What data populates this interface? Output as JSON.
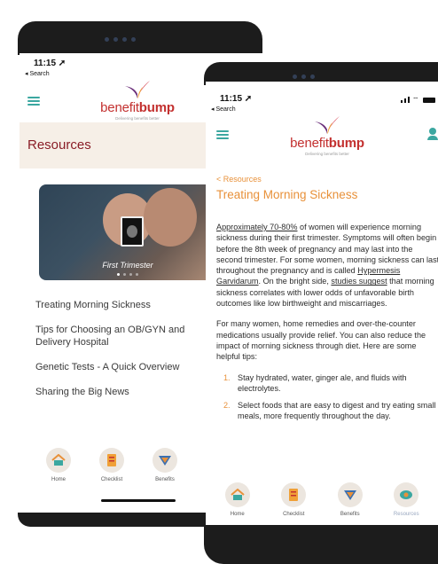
{
  "back_phone": {
    "status_time": "11:15",
    "status_back": "◂ Search",
    "logo": {
      "word_1": "benefit",
      "word_2": "bump",
      "tagline": "Delivering benefits better"
    },
    "section_title": "Resources",
    "carousel_caption": "First Trimester",
    "links": [
      "Treating Morning Sickness",
      "Tips for Choosing an OB/GYN and Delivery Hospital",
      "Genetic Tests - A Quick Overview",
      "Sharing the Big News"
    ],
    "nav": [
      "Home",
      "Checklist",
      "Benefits"
    ]
  },
  "front_phone": {
    "status_time": "11:15",
    "status_back": "◂ Search",
    "logo": {
      "word_1": "benefit",
      "word_2": "bump",
      "tagline": "Delivering benefits better"
    },
    "back_link": "< Resources",
    "title": "Treating Morning Sickness",
    "p1": {
      "link_1": "Approximately 70-80%",
      "t1": " of women will experience morning sickness during their first trimester. Symptoms will often begin before the 8th week of pregnancy and may last into the second trimester. For some women, morning sickness can last throughout the pregnancy and is called ",
      "link_2": "Hypermesis Garvidarum",
      "t2": ". On the bright side, ",
      "link_3": "studies suggest",
      "t3": " that morning sickness correlates with lower odds of unfavorable birth outcomes like low birthweight and miscarriages."
    },
    "p2": "For many women, home remedies and over-the-counter medications usually provide relief. You can also reduce the impact of morning sickness through diet. Here are some helpful tips:",
    "tips": [
      {
        "num": "1.",
        "text": "Stay hydrated, water, ginger ale, and fluids with electrolytes."
      },
      {
        "num": "2.",
        "text": "Select foods that are easy to digest and try eating small meals, more frequently throughout the day."
      }
    ],
    "nav": [
      "Home",
      "Checklist",
      "Benefits",
      "Resources"
    ]
  },
  "colors": {
    "accent_orange": "#e8913a",
    "brand_red": "#c3302f",
    "resources_title": "#8a1d27",
    "teal": "#3ba7a0",
    "header_band": "#f6efe7"
  }
}
